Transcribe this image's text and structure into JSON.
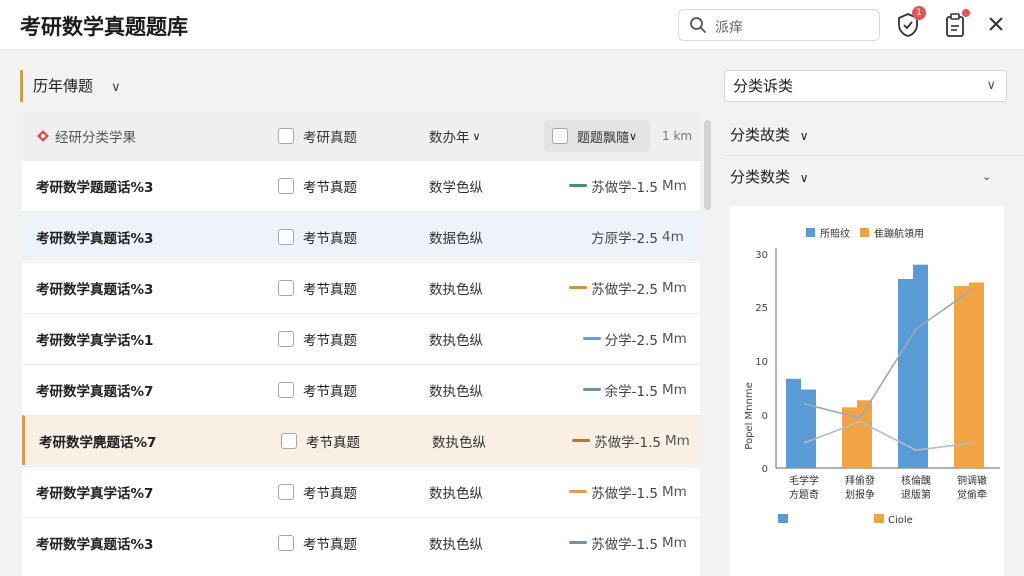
{
  "app": {
    "title": "考研数学真题题库"
  },
  "search": {
    "placeholder": "派痒"
  },
  "header_icons": {
    "notif_count": "1"
  },
  "section": {
    "title": "历年傳题"
  },
  "table": {
    "headers": {
      "name": "经研分类学果",
      "exam": "考研真题",
      "year": "数办年",
      "filter": "题题飘隨",
      "size": "1 km"
    },
    "rows": [
      {
        "name": "考研数学题题话%3",
        "exam": "考节真题",
        "type": "数学色纵",
        "bar_label": "苏做学-1.5",
        "unit": "Mm",
        "bar_color": "#3a9a6a",
        "style": "normal"
      },
      {
        "name": "考研数学真题话%3",
        "exam": "考节真题",
        "type": "数据色纵",
        "bar_label": "方原学-2.5",
        "unit": "4m",
        "bar_color": "",
        "style": "alt"
      },
      {
        "name": "考研数学真题话%3",
        "exam": "考节真题",
        "type": "数执色纵",
        "bar_label": "苏做学-2.5",
        "unit": "Mm",
        "bar_color": "#e08e3a",
        "style": "normal"
      },
      {
        "name": "考研数学真学话%1",
        "exam": "考节真题",
        "type": "数执色纵",
        "bar_label": "分学-2.5",
        "unit": "Mm",
        "bar_color": "#6b9bd1",
        "style": "normal"
      },
      {
        "name": "考研数学真题话%7",
        "exam": "考节真题",
        "type": "数执色纵",
        "bar_label": "余学-1.5",
        "unit": "Mm",
        "bar_color": "#6b8fb5",
        "style": "normal"
      },
      {
        "name": "考研数学麂题话%7",
        "exam": "考节真题",
        "type": "数执色纵",
        "bar_label": "苏做学-1.5",
        "unit": "Mm",
        "bar_color": "#b0793a",
        "style": "sel"
      },
      {
        "name": "考研数学真学话%7",
        "exam": "考节真题",
        "type": "数执色纵",
        "bar_label": "苏做学-1.5",
        "unit": "Mm",
        "bar_color": "#e89a52",
        "style": "normal"
      },
      {
        "name": "考研数学真题话%3",
        "exam": "考节真题",
        "type": "数执色纵",
        "bar_label": "苏做学-1.5",
        "unit": "Mm",
        "bar_color": "#7a8fa8",
        "style": "normal"
      }
    ]
  },
  "right_panel": {
    "select_value": "分类诉类",
    "link1": "分类故类",
    "link2": "分类数类"
  },
  "chart_data": {
    "type": "bar",
    "legend": [
      {
        "name": "所賠纹",
        "color": "#5b9bd5"
      },
      {
        "name": "隹蹦航領用",
        "color": "#f2a444"
      }
    ],
    "bottom_legend": [
      {
        "name": "",
        "color": "#5b9bd5"
      },
      {
        "name": "Ciole",
        "color": "#f2a444"
      }
    ],
    "ylabel": "Popel Mnnme",
    "yticks": [
      "30",
      "25",
      "10",
      "0",
      "0"
    ],
    "categories": [
      {
        "line1": "毛学学",
        "line2": "方题奇"
      },
      {
        "line1": "拜偷發",
        "line2": "划报争"
      },
      {
        "line1": "核倫醜",
        "line2": "退版第"
      },
      {
        "line1": "铜调辙",
        "line2": "觉偷牵"
      }
    ],
    "series": [
      {
        "name": "所賠纹",
        "color": "#5b9bd5",
        "values": [
          [
            25,
            22
          ],
          [
            0,
            0
          ],
          [
            53,
            57
          ],
          [
            0,
            0
          ]
        ]
      },
      {
        "name": "隹蹦航領用",
        "color": "#f2a444",
        "values": [
          [
            0,
            0
          ],
          [
            17,
            19
          ],
          [
            0,
            0
          ],
          [
            51,
            52
          ]
        ]
      }
    ],
    "lines": [
      {
        "color": "#9aa8c0",
        "values": [
          18,
          14,
          39,
          50
        ]
      },
      {
        "color": "#b5bccb",
        "values": [
          7,
          13,
          5,
          7
        ]
      }
    ],
    "ylim": [
      0,
      60
    ]
  }
}
